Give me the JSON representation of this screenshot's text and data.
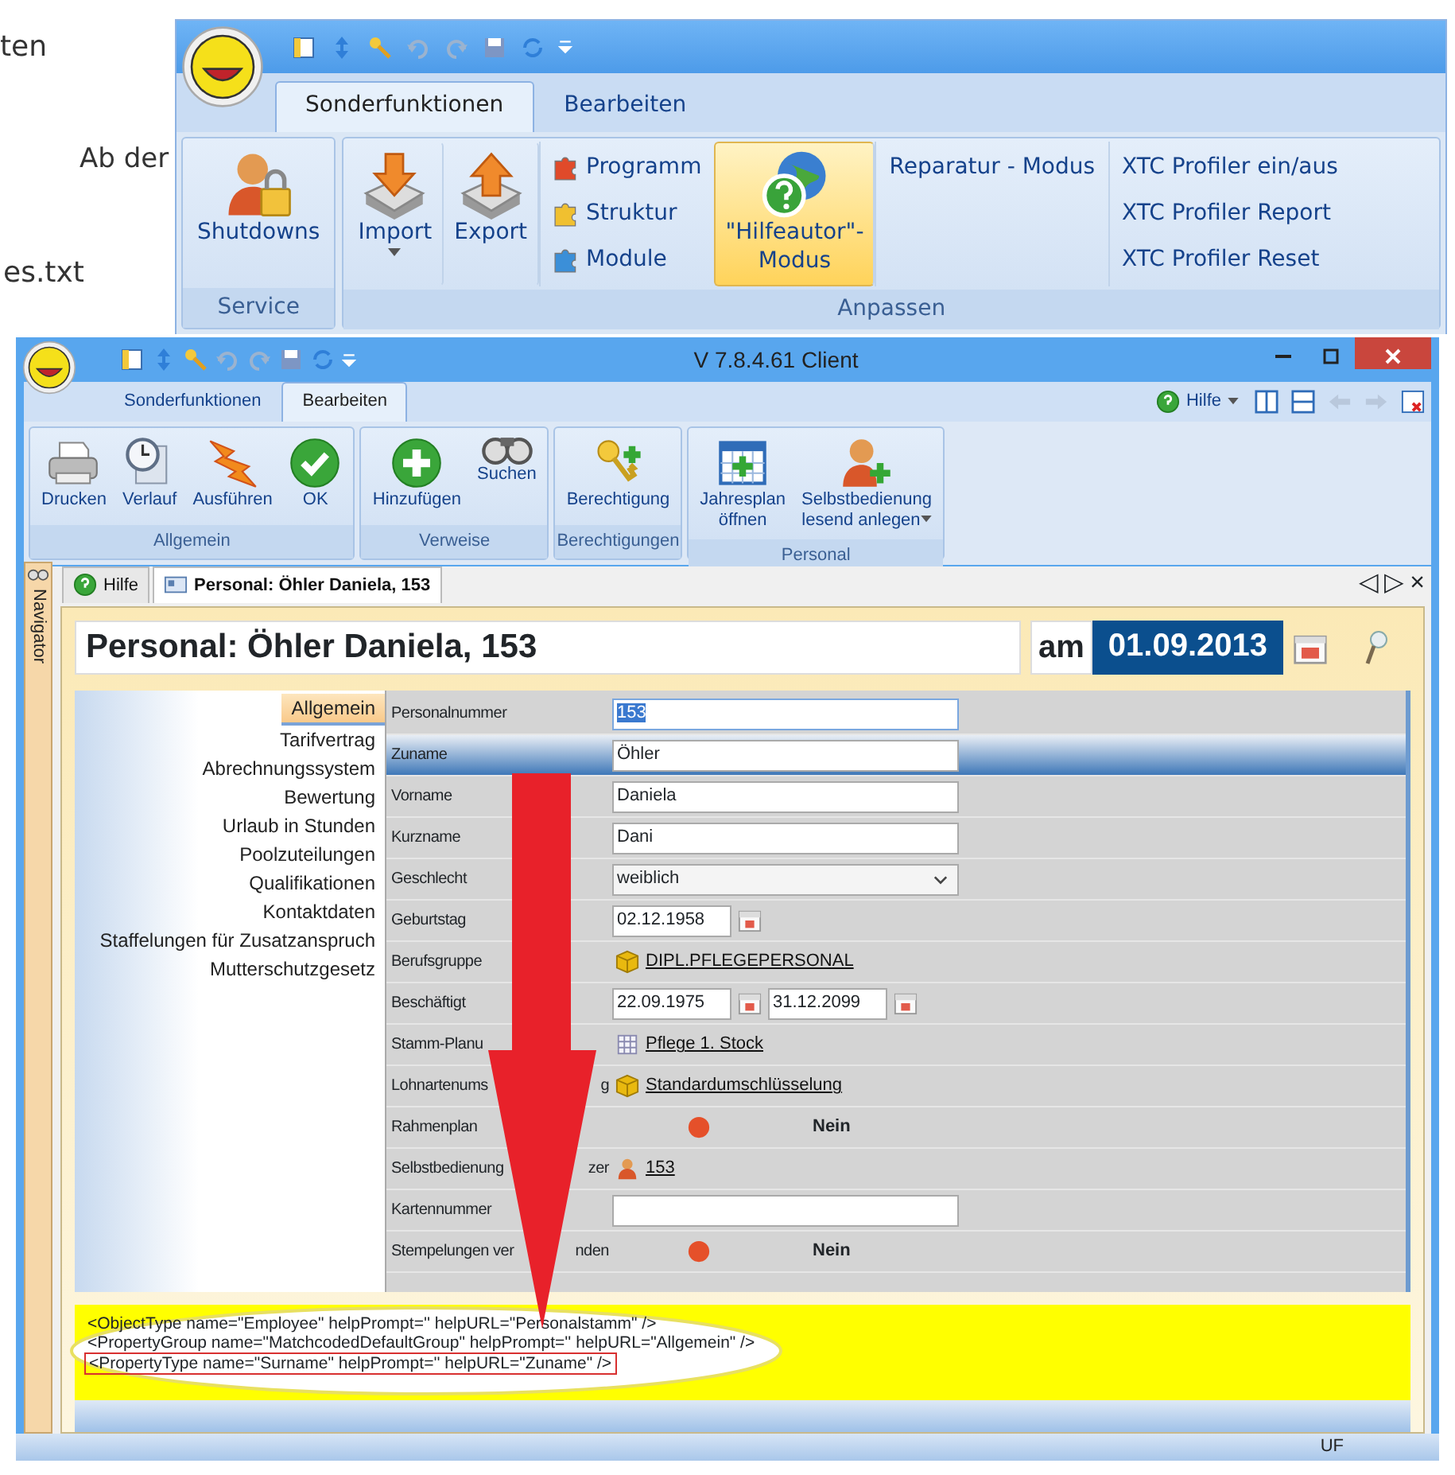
{
  "background_text": [
    "ten",
    "Ab der",
    "es.txt"
  ],
  "top_ribbon": {
    "tabs": [
      {
        "label": "Sonderfunktionen",
        "selected": true
      },
      {
        "label": "Bearbeiten",
        "selected": false
      }
    ],
    "groups": [
      {
        "label": "Service",
        "items": [
          {
            "kind": "large",
            "label": "Shutdowns",
            "dropdown": false,
            "highlighted": false
          }
        ]
      },
      {
        "label": "Anpassen",
        "items": [
          {
            "kind": "large",
            "label": "Import",
            "dropdown": true,
            "highlighted": false
          },
          {
            "kind": "large",
            "label": "Export",
            "dropdown": false,
            "highlighted": false
          },
          {
            "kind": "stack",
            "items": [
              {
                "kind": "icon",
                "label": "Programm"
              },
              {
                "kind": "icon",
                "label": "Struktur"
              },
              {
                "kind": "icon",
                "label": "Module"
              }
            ]
          },
          {
            "kind": "large",
            "label": "\"Hilfeautor\"-\nModus",
            "dropdown": false,
            "highlighted": true
          },
          {
            "kind": "stack",
            "items": [
              {
                "kind": "text",
                "label": "Reparatur - Modus"
              }
            ]
          },
          {
            "kind": "stack",
            "items": [
              {
                "kind": "text",
                "label": "XTC Profiler ein/aus"
              },
              {
                "kind": "text",
                "label": "XTC Profiler Report"
              },
              {
                "kind": "text",
                "label": "XTC Profiler Reset"
              }
            ]
          }
        ]
      }
    ]
  },
  "window": {
    "title": "V 7.8.4.61 Client",
    "tabs": [
      {
        "label": "Sonderfunktionen",
        "selected": false
      },
      {
        "label": "Bearbeiten",
        "selected": true
      }
    ],
    "help_menu": "Hilfe",
    "ribbon_groups": [
      {
        "label": "Allgemein",
        "items": [
          {
            "label": "Drucken",
            "dropdown": false
          },
          {
            "label": "Verlauf",
            "dropdown": false
          },
          {
            "label": "Ausführen",
            "dropdown": false
          },
          {
            "label": "OK",
            "dropdown": false
          }
        ]
      },
      {
        "label": "Verweise",
        "items": [
          {
            "label": "Hinzufügen",
            "dropdown": false
          },
          {
            "label": "Suchen",
            "dropdown": false
          }
        ]
      },
      {
        "label": "Berechtigungen",
        "items": [
          {
            "label": "Berechtigung",
            "dropdown": false
          }
        ]
      },
      {
        "label": "Personal",
        "items": [
          {
            "label": "Jahresplan\nöffnen",
            "dropdown": false
          },
          {
            "label": "Selbstbedienung\nlesend anlegen",
            "dropdown": true
          }
        ]
      }
    ],
    "navigator": "Navigator",
    "document_tabs": [
      {
        "label": "Hilfe",
        "selected": false
      },
      {
        "label": "Personal: Öhler Daniela, 153",
        "selected": true
      }
    ],
    "tab_nav": [
      "◁",
      "▷",
      "×"
    ],
    "record": {
      "title": "Personal: Öhler Daniela, 153",
      "date_prefix": "am",
      "date": "01.09.2013"
    },
    "sections": [
      {
        "label": "Allgemein",
        "selected": true
      },
      {
        "label": "Tarifvertrag",
        "selected": false
      },
      {
        "label": "Abrechnungssystem",
        "selected": false
      },
      {
        "label": "Bewertung",
        "selected": false
      },
      {
        "label": "Urlaub in Stunden",
        "selected": false
      },
      {
        "label": "Poolzuteilungen",
        "selected": false
      },
      {
        "label": "Qualifikationen",
        "selected": false
      },
      {
        "label": "Kontaktdaten",
        "selected": false
      },
      {
        "label": "Staffelungen für Zusatzanspruch",
        "selected": false
      },
      {
        "label": "Mutterschutzgesetz",
        "selected": false
      }
    ],
    "fields": [
      {
        "label": "Personalnummer",
        "kind": "input",
        "value": "153",
        "highlighted": true,
        "selected": false
      },
      {
        "label": "Zuname",
        "kind": "input",
        "value": "Öhler",
        "highlighted": false,
        "selected": true
      },
      {
        "label": "Vorname",
        "kind": "input",
        "value": "Daniela",
        "highlighted": false,
        "selected": false
      },
      {
        "label": "Kurzname",
        "kind": "input",
        "value": "Dani",
        "highlighted": false,
        "selected": false
      },
      {
        "label": "Geschlecht",
        "kind": "select",
        "value": "weiblich",
        "selected": false
      },
      {
        "label": "Geburtstag",
        "kind": "date",
        "value": "02.12.1958",
        "selected": false
      },
      {
        "label": "Berufsgruppe",
        "kind": "link",
        "value": "DIPL.PFLEGEPERSONAL",
        "selected": false
      },
      {
        "label": "Beschäftigt",
        "kind": "range",
        "value": "22.09.1975",
        "value_to": "31.12.2099",
        "selected": false
      },
      {
        "label": "Stamm-Planu",
        "kind": "link",
        "value": "Pflege 1. Stock",
        "selected": false
      },
      {
        "label": "Lohnartenums",
        "label_tail": "g",
        "kind": "link",
        "value": "Standardumschlüsselung",
        "selected": false
      },
      {
        "label": "Rahmenplan",
        "kind": "flag",
        "on": false,
        "value": "Nein",
        "selected": false
      },
      {
        "label": "Selbstbedienung",
        "label_tail": "zer",
        "kind": "link",
        "value": "153",
        "selected": false
      },
      {
        "label": "Kartennummer",
        "kind": "input",
        "highlighted": false,
        "selected": false
      },
      {
        "label": "Stempelungen ver",
        "label_tail": "nden",
        "kind": "flag",
        "on": false,
        "value": "Nein",
        "selected": false
      }
    ],
    "help_xml": [
      {
        "text": "<ObjectType name=\"Employee\" helpPrompt='' helpURL=\"Personalstamm\" />",
        "boxed": false
      },
      {
        "text": "<PropertyGroup name=\"MatchcodedDefaultGroup\" helpPrompt='' helpURL=\"Allgemein\" />",
        "boxed": false
      },
      {
        "text": "<PropertyType name=\"Surname\" helpPrompt='' helpURL=\"Zuname\" />",
        "boxed": true
      }
    ],
    "status_bar": "UF"
  }
}
